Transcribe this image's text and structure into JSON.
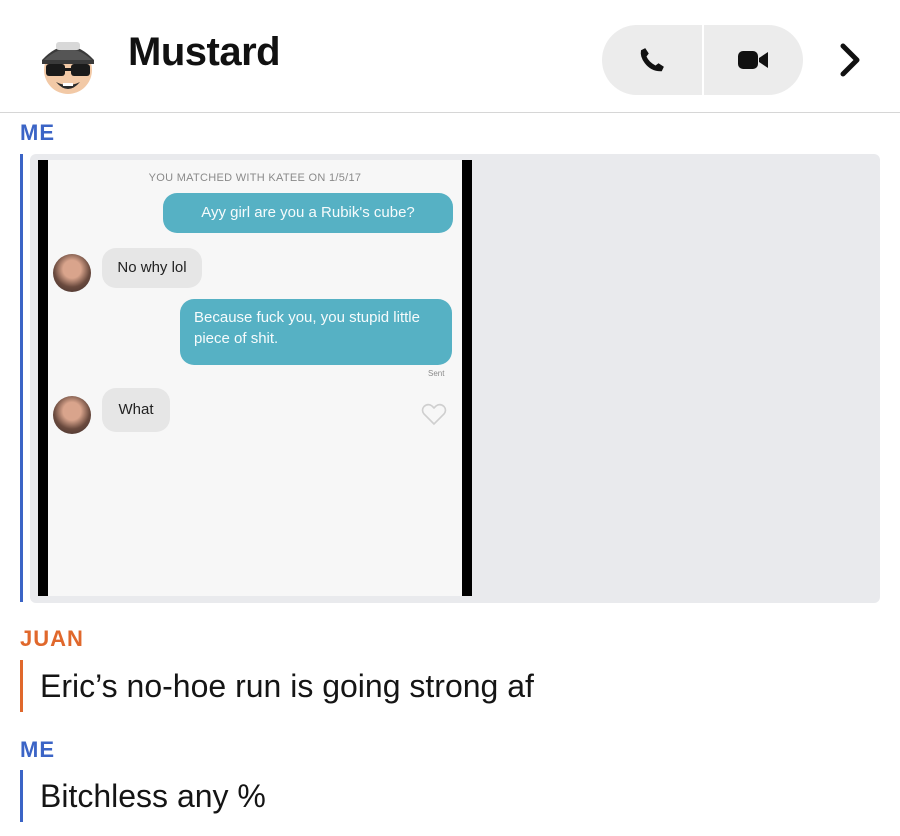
{
  "header": {
    "title": "Mustard",
    "call_icon": "phone-icon",
    "video_icon": "video-camera-icon",
    "more_icon": "chevron-right-icon"
  },
  "messages": [
    {
      "sender": "ME",
      "color": "#3b64c6",
      "type": "image"
    },
    {
      "sender": "JUAN",
      "color": "#e0682c",
      "type": "text",
      "text": "Eric’s no-hoe run is going strong af"
    },
    {
      "sender": "ME",
      "color": "#3b64c6",
      "type": "text",
      "text": "Bitchless any %"
    }
  ],
  "screenshot": {
    "matched_text": "YOU MATCHED WITH KATEE ON 1/5/17",
    "bubbles": [
      {
        "from": "me",
        "text": "Ayy girl are you a Rubik's cube?"
      },
      {
        "from": "her",
        "text": "No why lol"
      },
      {
        "from": "me",
        "text": "Because fuck you, you stupid little piece of shit."
      },
      {
        "from": "her",
        "text": "What"
      }
    ],
    "sent_label": "Sent",
    "colors": {
      "outgoing": "#56b1c4",
      "incoming": "#e6e6e6"
    }
  }
}
